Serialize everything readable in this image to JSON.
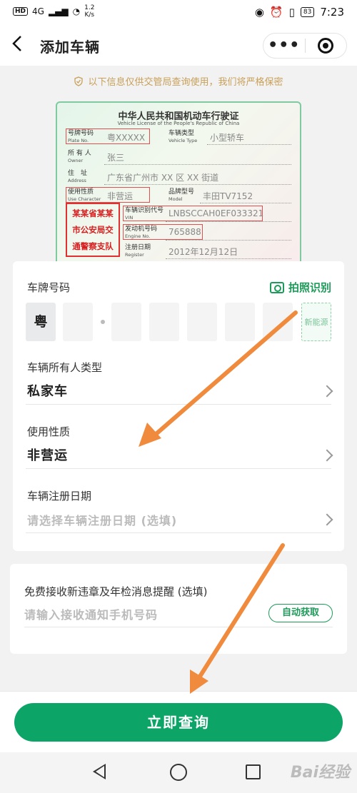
{
  "status_bar": {
    "network": "4G",
    "hd": "HD",
    "speed_value": "1.2",
    "speed_unit": "K/s",
    "battery": "83",
    "time": "7:23"
  },
  "header": {
    "title": "添加车辆"
  },
  "notice": "以下信息仅供交管局查询使用，我们将严格保密",
  "license": {
    "title": "中华人民共和国机动车行驶证",
    "subtitle": "Vehicle License of the People's Republic of China",
    "plate_label": "号牌号码",
    "plate_label_en": "Plate No.",
    "plate_value": "粤XXXXX",
    "type_label": "车辆类型",
    "type_label_en": "Vehicle Type",
    "type_value": "小型轿车",
    "owner_label": "所 有 人",
    "owner_label_en": "Owner",
    "owner_value": "张三",
    "address_label": "住　址",
    "address_label_en": "Address",
    "address_value": "广东省广州市 XX 区 XX 街道",
    "use_label": "使用性质",
    "use_label_en": "Use Character",
    "use_value": "非营运",
    "model_label": "品牌型号",
    "model_label_en": "Model",
    "model_value": "丰田TV7152",
    "vin_label": "车辆识别代号",
    "vin_label_en": "VIN",
    "vin_value": "LNBSCCAH0EF033321",
    "engine_label": "发动机号码",
    "engine_label_en": "Engine No.",
    "engine_value": "765888",
    "register_label": "注册日期",
    "register_label_en": "Register",
    "register_value": "2012年12月12日",
    "stamp": [
      "某某省某某",
      "市公安局交",
      "通警察支队"
    ]
  },
  "form": {
    "plate_label": "车牌号码",
    "photo_button": "拍照识别",
    "province": "粤",
    "new_energy": "新能源",
    "owner_type_label": "车辆所有人类型",
    "owner_type_value": "私家车",
    "use_label": "使用性质",
    "use_value": "非营运",
    "register_label": "车辆注册日期",
    "register_placeholder": "请选择车辆注册日期 (选填)"
  },
  "notify": {
    "label": "免费接收新违章及年检消息提醒 (选填)",
    "placeholder": "请输入接收通知手机号码",
    "auto_button": "自动获取"
  },
  "submit": "立即查询",
  "watermark": "Bai经验",
  "colors": {
    "accent": "#0da567",
    "arrow": "#f08a3c",
    "notice": "#c8a05a"
  }
}
